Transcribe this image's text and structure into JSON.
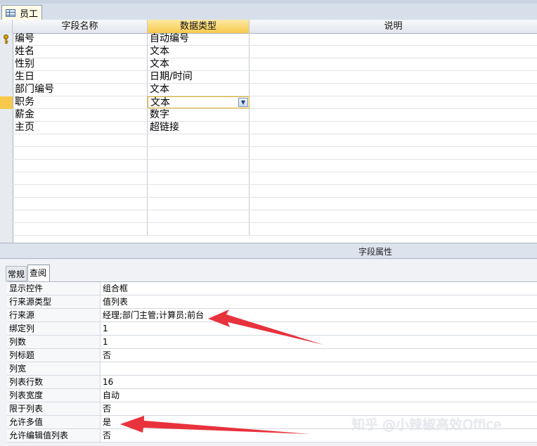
{
  "document_tab": {
    "label": "员工",
    "icon": "table-icon"
  },
  "grid": {
    "headers": [
      "字段名称",
      "数据类型",
      "说明"
    ],
    "fields": [
      {
        "name": "编号",
        "type": "自动编号",
        "primary_key": true
      },
      {
        "name": "姓名",
        "type": "文本"
      },
      {
        "name": "性别",
        "type": "文本"
      },
      {
        "name": "生日",
        "type": "日期/时间"
      },
      {
        "name": "部门编号",
        "type": "文本"
      },
      {
        "name": "职务",
        "type": "文本",
        "selected": true
      },
      {
        "name": "薪金",
        "type": "数字"
      },
      {
        "name": "主页",
        "type": "超链接"
      }
    ]
  },
  "field_properties": {
    "title": "字段属性",
    "tabs": [
      "常规",
      "查阅"
    ],
    "active_tab": "查阅",
    "rows": [
      {
        "label": "显示控件",
        "value": "组合框"
      },
      {
        "label": "行来源类型",
        "value": "值列表"
      },
      {
        "label": "行来源",
        "value": "经理;部门主管;计算员;前台"
      },
      {
        "label": "绑定列",
        "value": "1"
      },
      {
        "label": "列数",
        "value": "1"
      },
      {
        "label": "列标题",
        "value": "否"
      },
      {
        "label": "列宽",
        "value": ""
      },
      {
        "label": "列表行数",
        "value": "16"
      },
      {
        "label": "列表宽度",
        "value": "自动"
      },
      {
        "label": "限于列表",
        "value": "否"
      },
      {
        "label": "允许多值",
        "value": "是"
      },
      {
        "label": "允许编辑值列表",
        "value": "否"
      }
    ]
  },
  "annotation_color": "#e8323c",
  "watermark": "知乎 @小辣椒高效Office"
}
